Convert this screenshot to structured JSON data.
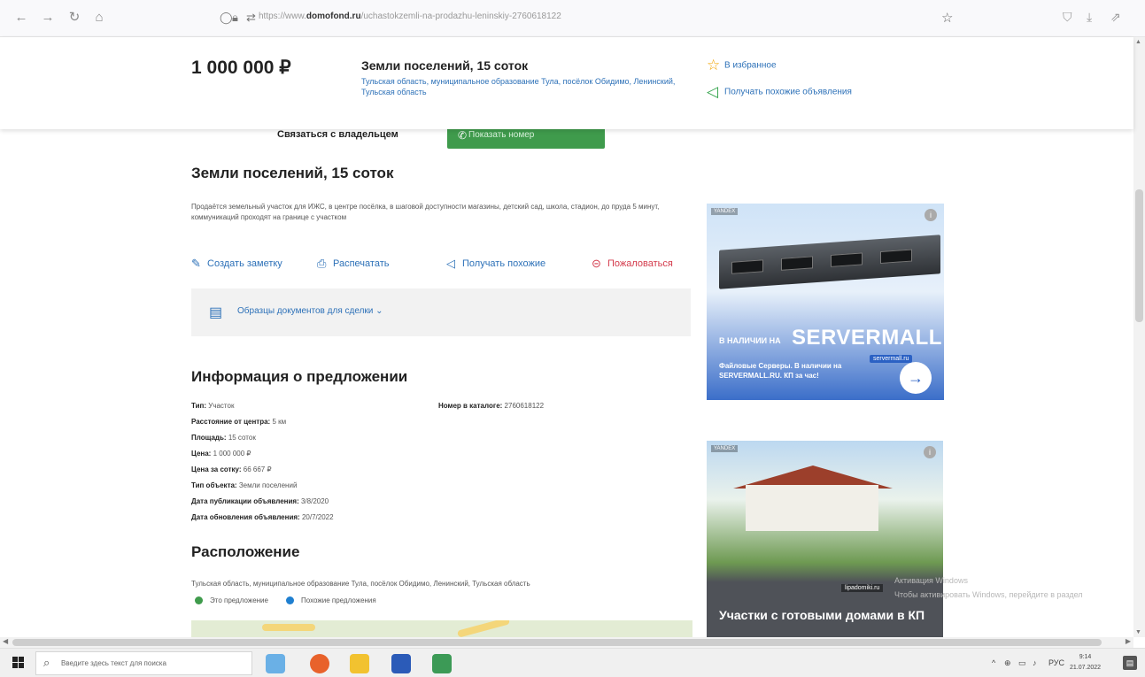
{
  "browser": {
    "url_prefix": "https://www.",
    "url_domain": "domofond.ru",
    "url_path": "/uchastokzemli-na-prodazhu-leninskiy-2760618122"
  },
  "sticky": {
    "price": "1 000 000 ₽",
    "title": "Земли поселений, 15 соток",
    "address": "Тульская область, муниципальное образование Тула, посёлок Обидимо, Ленинский, Тульская область",
    "favorite": "В избранное",
    "similar_notify": "Получать похожие объявления"
  },
  "contact": {
    "label": "Связаться с владельцем",
    "phone_button": "Показать номер"
  },
  "listing": {
    "title": "Земли поселений, 15 соток",
    "description": "Продаётся земельный участок для ИЖС, в центре посёлка, в шаговой доступности магазины, детский сад, школа, стадион, до пруда 5 минут, коммуникаций проходят на границе с участком",
    "actions": {
      "note": "Создать заметку",
      "print": "Распечатать",
      "similar": "Получать похожие",
      "report": "Пожаловаться"
    },
    "docs": "Образцы документов для сделки"
  },
  "info": {
    "heading": "Информация о предложении",
    "rows": [
      {
        "label": "Тип:",
        "value": "Участок"
      },
      {
        "label": "Расстояние от центра:",
        "value": "5 км"
      },
      {
        "label": "Площадь:",
        "value": "15 соток"
      },
      {
        "label": "Цена:",
        "value": "1 000 000 ₽"
      },
      {
        "label": "Цена за сотку:",
        "value": "66 667 ₽"
      },
      {
        "label": "Тип объекта:",
        "value": "Земли поселений"
      },
      {
        "label": "Дата публикации объявления:",
        "value": "3/8/2020"
      },
      {
        "label": "Дата обновления объявления:",
        "value": "20/7/2022"
      }
    ],
    "catalog_label": "Номер в каталоге:",
    "catalog_value": "2760618122"
  },
  "location": {
    "heading": "Расположение",
    "address": "Тульская область, муниципальное образование Тула, посёлок Обидимо, Ленинский, Тульская область",
    "legend_this": "Это предложение",
    "legend_similar": "Похожие предложения",
    "legend_this_color": "#3f9b4c",
    "legend_similar_color": "#1f7fd0"
  },
  "ads": {
    "ad1": {
      "tag": "YANDEX",
      "brand_prefix": "В НАЛИЧИИ НА",
      "brand": "SERVERMALL",
      "site": "servermall.ru",
      "text": "Файловые Серверы. В наличии на SERVERMALL.RU. КП за час!"
    },
    "ad2": {
      "tag": "YANDEX",
      "site": "lipadomiki.ru",
      "title": "Участки с готовыми домами в КП"
    }
  },
  "watermark": {
    "line1": "Активация Windows",
    "line2": "Чтобы активировать Windows, перейдите в раздел"
  },
  "taskbar": {
    "search_placeholder": "Введите здесь текст для поиска",
    "lang": "РУС",
    "time": "9:14",
    "date": "21.07.2022"
  },
  "colors": {
    "accent_green": "#3f9b4c",
    "link_blue": "#2d71b8",
    "favorite_star": "#f2a400",
    "report_red": "#d43b4c"
  }
}
